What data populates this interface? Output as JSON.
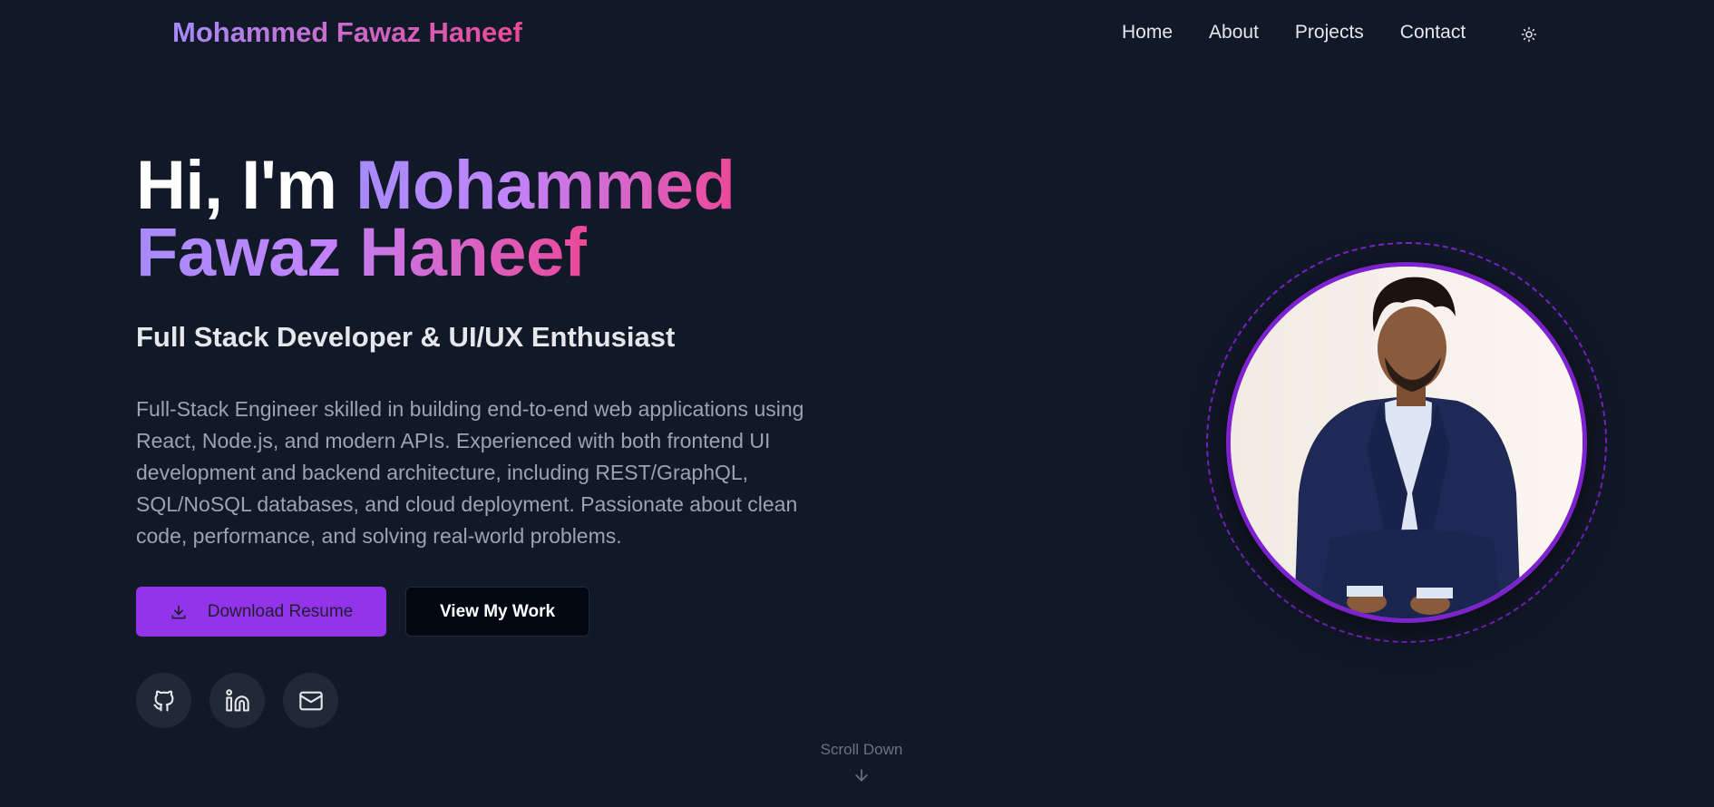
{
  "nav": {
    "brand": "Mohammed Fawaz Haneef",
    "links": [
      "Home",
      "About",
      "Projects",
      "Contact"
    ],
    "theme_icon": "sun-icon"
  },
  "hero": {
    "greeting": "Hi, I'm ",
    "name_line1": "Mohammed",
    "name_line2": "Fawaz Haneef",
    "subtitle": "Full Stack Developer & UI/UX Enthusiast",
    "bio": "Full-Stack Engineer skilled in building end-to-end web applications using React, Node.js, and modern APIs. Experienced with both frontend UI development and backend architecture, including REST/GraphQL, SQL/NoSQL databases, and cloud deployment. Passionate about clean code, performance, and solving real-world problems.",
    "download_label": "Download Resume",
    "work_label": "View My Work",
    "socials": [
      "github-icon",
      "linkedin-icon",
      "mail-icon"
    ],
    "scroll_label": "Scroll Down"
  },
  "colors": {
    "background": "#111827",
    "accent": "#9333ea",
    "gradient_start": "#a78bfa",
    "gradient_end": "#ec4899"
  }
}
